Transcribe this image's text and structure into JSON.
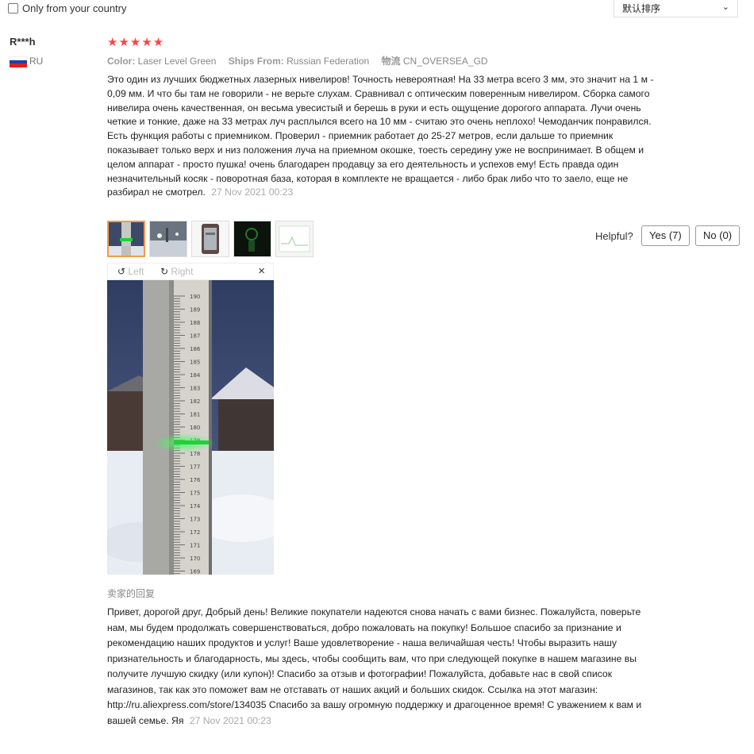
{
  "filter": {
    "label": "Only from your country",
    "checked": false
  },
  "sort": {
    "selected": "默认排序"
  },
  "review": {
    "user": "R***h",
    "country_code": "RU",
    "rating": 5,
    "stars": "★★★★★",
    "props": [
      {
        "label": "Color:",
        "value": "Laser Level Green"
      },
      {
        "label": "Ships From:",
        "value": "Russian Federation"
      },
      {
        "label": "物流",
        "value": "CN_OVERSEA_GD"
      }
    ],
    "text": "Это один из лучших бюджетных лазерных нивелиров! Точность невероятная! На 33 метра всего 3 мм, это значит на 1 м - 0,09 мм. И что бы там не говорили - не верьте слухам. Сравнивал с оптическим поверенным нивелиром. Сборка самого нивелира очень качественная, он весьма увесистый и берешь в руки и есть ощущение дорогого аппарата. Лучи очень четкие и тонкие, даже на 33 метрах луч расплылся всего на 10 мм - считаю это очень неплохо! Чемоданчик понравился. Есть функция работы с приемником. Проверил - приемник работает до 25-27 метров, если дальше то приемник показывает только верх и низ положения луча на приемном окошке, тоесть середину уже не воспринимает. В общем и целом аппарат - просто пушка! очень благодарен продавцу за его деятельность и успехов ему! Есть правда один незначительный косяк - поворотная база, которая в комплекте не вращается - либо брак либо что то заело, еще не разбирал не смотрел.",
    "date": "27 Nov 2021 00:23",
    "photo_count": 5,
    "selected_photo": 1
  },
  "helpful": {
    "label": "Helpful?",
    "yes": "Yes (7)",
    "no": "No (0)"
  },
  "viewer": {
    "left": "Left",
    "right": "Right",
    "close": "×"
  },
  "seller": {
    "heading": "卖家的回复",
    "text": "Привет, дорогой друг, Добрый день! Великие покупатели надеются снова начать с вами бизнес. Пожалуйста, поверьте нам, мы будем продолжать совершенствоваться, добро пожаловать на покупку! Большое спасибо за признание и рекомендацию наших продуктов и услуг! Ваше удовлетворение - наша величайшая честь! Чтобы выразить нашу признательность и благодарность, мы здесь, чтобы сообщить вам, что при следующей покупке в нашем магазине вы получите лучшую скидку (или купон)! Спасибо за отзыв и фотографии! Пожалуйста, добавьте нас в свой список магазинов, так как это поможет вам не отставать от наших акций и больших скидок. Ссылка на этот магазин: http://ru.aliexpress.com/store/134035 Спасибо за вашу огромную поддержку и драгоценное время! С уважением к вам и вашей семье. Яя",
    "date": "27 Nov 2021 00:23"
  },
  "colors": {
    "star": "#ff4747",
    "selected_border": "#f39b4a",
    "laser": "#1fd03a"
  },
  "ruler_ticks": [
    "190",
    "189",
    "188",
    "187",
    "186",
    "185",
    "184",
    "183",
    "182",
    "181",
    "180",
    "179",
    "178",
    "177",
    "176",
    "175",
    "174",
    "173",
    "172",
    "171",
    "170",
    "169"
  ]
}
